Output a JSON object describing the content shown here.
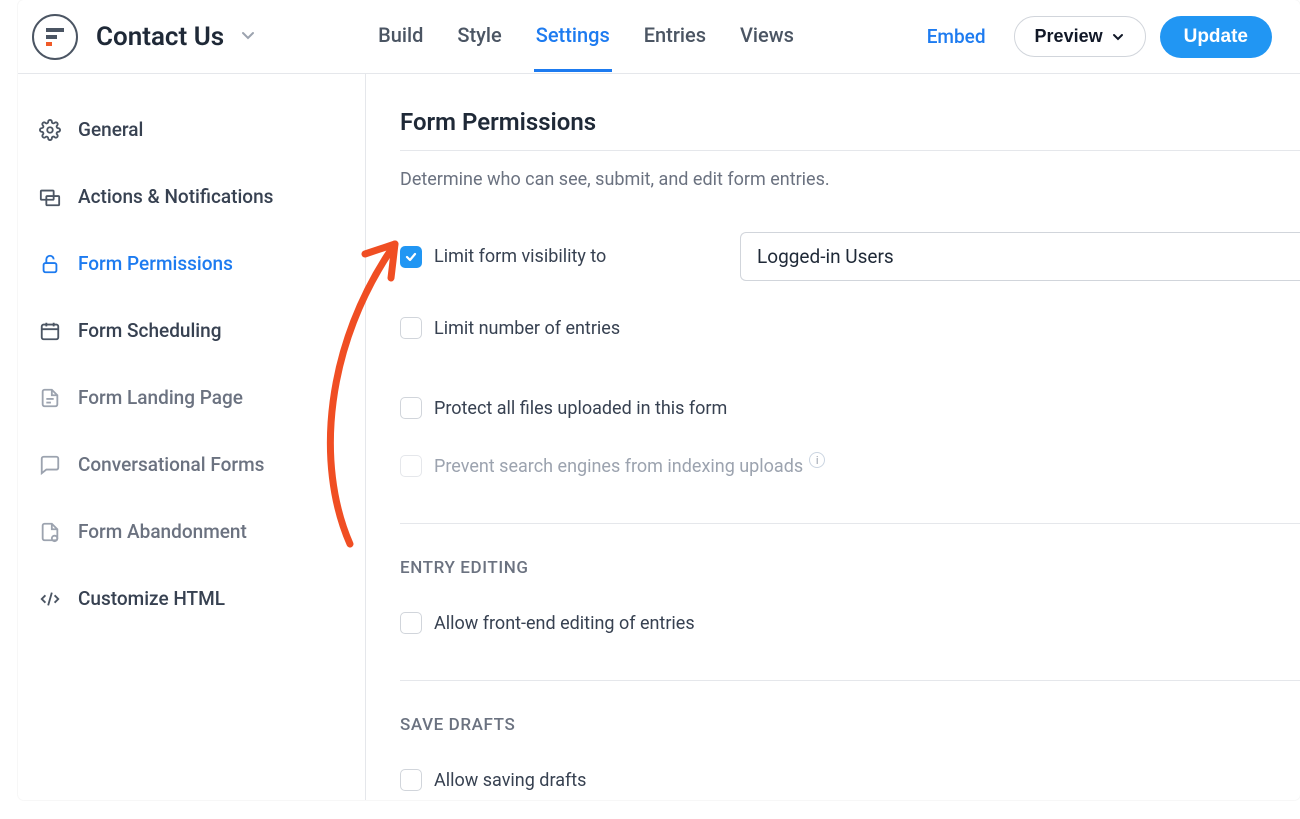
{
  "header": {
    "form_title": "Contact Us",
    "tabs": {
      "build": "Build",
      "style": "Style",
      "settings": "Settings",
      "entries": "Entries",
      "views": "Views"
    },
    "embed": "Embed",
    "preview": "Preview",
    "update": "Update"
  },
  "sidebar": {
    "general": "General",
    "actions": "Actions & Notifications",
    "permissions": "Form Permissions",
    "scheduling": "Form Scheduling",
    "landing": "Form Landing Page",
    "conversational": "Conversational Forms",
    "abandonment": "Form Abandonment",
    "customize_html": "Customize HTML"
  },
  "main": {
    "title": "Form Permissions",
    "subtitle": "Determine who can see, submit, and edit form entries.",
    "limit_visibility": "Limit form visibility to",
    "visibility_value": "Logged-in Users",
    "limit_entries": "Limit number of entries",
    "protect_files": "Protect all files uploaded in this form",
    "prevent_indexing": "Prevent search engines from indexing uploads",
    "entry_editing": "ENTRY EDITING",
    "allow_front_edit": "Allow front-end editing of entries",
    "save_drafts": "SAVE DRAFTS",
    "allow_saving_drafts": "Allow saving drafts"
  }
}
